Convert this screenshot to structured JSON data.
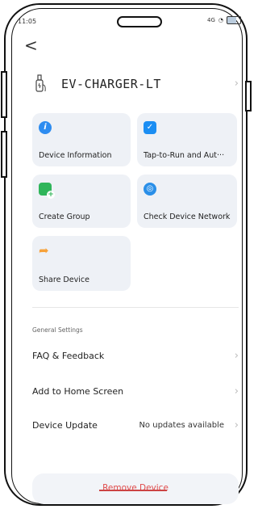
{
  "status": {
    "time": "11:05",
    "network": "4G"
  },
  "nav": {
    "back": "<"
  },
  "device": {
    "name": "EV-CHARGER-LT"
  },
  "actions": [
    {
      "label": "Device Information",
      "icon": "info-icon",
      "color": "#2d8cf0"
    },
    {
      "label": "Tap-to-Run and Aut···",
      "icon": "check-shield-icon",
      "color": "#1b8ef3"
    },
    {
      "label": "Create Group",
      "icon": "add-group-icon",
      "color": "#2fb55a"
    },
    {
      "label": "Check Device Network",
      "icon": "network-icon",
      "color": "#2a8fe8"
    },
    {
      "label": "Share Device",
      "icon": "share-arrow-icon",
      "color": "#f7a23a"
    }
  ],
  "general": {
    "title": "General Settings",
    "rows": [
      {
        "label": "FAQ & Feedback",
        "value": ""
      },
      {
        "label": "Add to Home Screen",
        "value": ""
      },
      {
        "label": "Device Update",
        "value": "No updates available"
      }
    ]
  },
  "remove": {
    "label": "Remove Device"
  }
}
